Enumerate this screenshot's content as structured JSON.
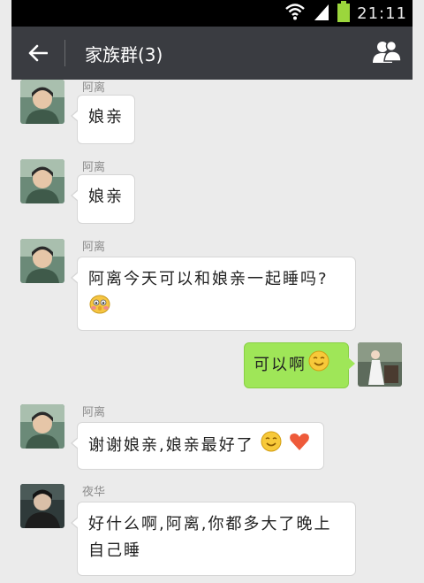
{
  "status": {
    "time": "21:11"
  },
  "header": {
    "title": "家族群(3)"
  },
  "messages": [
    {
      "sender": "阿离",
      "text": "娘亲"
    },
    {
      "sender": "阿离",
      "text": "娘亲"
    },
    {
      "sender": "阿离",
      "text": "阿离今天可以和娘亲一起睡吗?"
    },
    {
      "sender": "",
      "text": "可以啊"
    },
    {
      "sender": "阿离",
      "text": "谢谢娘亲,娘亲最好了"
    },
    {
      "sender": "夜华",
      "text_line1": "好什么啊,阿离,你都多大了晚上",
      "text_line2": "自己睡"
    }
  ],
  "colors": {
    "header_bg": "#3a3c41",
    "sent_bubble": "#9fe658",
    "received_bubble": "#ffffff"
  },
  "icons": [
    "wifi-icon",
    "signal-icon",
    "battery-icon",
    "back-arrow-icon",
    "group-members-icon",
    "smile-emoji",
    "heart-emoji",
    "shy-emoji"
  ]
}
